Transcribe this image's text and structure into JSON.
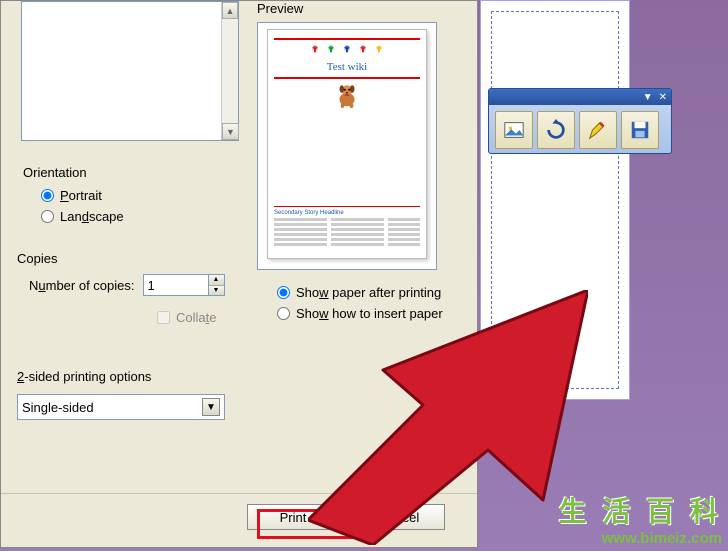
{
  "preview": {
    "label": "Preview",
    "title": "Test wiki"
  },
  "orientation": {
    "label": "Orientation",
    "portrait": "Portrait",
    "landscape": "Landscape",
    "selected": "portrait"
  },
  "copies": {
    "label": "Copies",
    "number_label": "Number of copies:",
    "value": "1",
    "collate": "Collate"
  },
  "two_sided": {
    "label": "2-sided printing options",
    "value": "Single-sided"
  },
  "show": {
    "paper": "Show paper after printing",
    "insert": "Show how to insert paper",
    "selected": "paper"
  },
  "buttons": {
    "print": "Print",
    "cancel": "Cancel"
  },
  "story": {
    "headline": "Secondary Story Headline"
  },
  "watermark": {
    "chars": "生 活 百 科",
    "url": "www.bimeiz.com"
  }
}
